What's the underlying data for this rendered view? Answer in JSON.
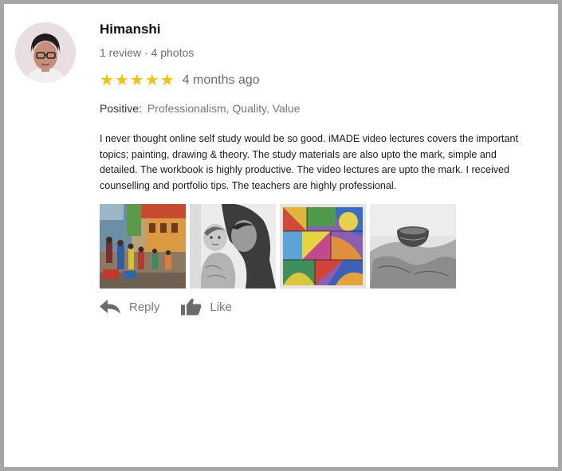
{
  "review": {
    "author": "Himanshi",
    "meta": "1 review · 4 photos",
    "rating": 5,
    "stars": [
      "★",
      "★",
      "★",
      "★",
      "★"
    ],
    "time_ago": "4 months ago",
    "positive_label": "Positive:",
    "positive_values": "Professionalism, Quality, Value",
    "text": "I never thought online self study would be so good. iMADE video lectures covers the important topics; painting, drawing & theory. The study materials are also upto the mark, simple and detailed. The workbook is highly productive. The video lectures are upto the mark. I received counselling and portfolio tips. The teachers are highly professional."
  },
  "actions": {
    "reply_label": "Reply",
    "like_label": "Like"
  },
  "icons": {
    "avatar": "avatar-photo",
    "reply": "reply-icon",
    "like": "thumbs-up-icon"
  },
  "colors": {
    "star": "#f5c20a",
    "action_gray": "#777777",
    "page_border": "#a6a6a6"
  }
}
